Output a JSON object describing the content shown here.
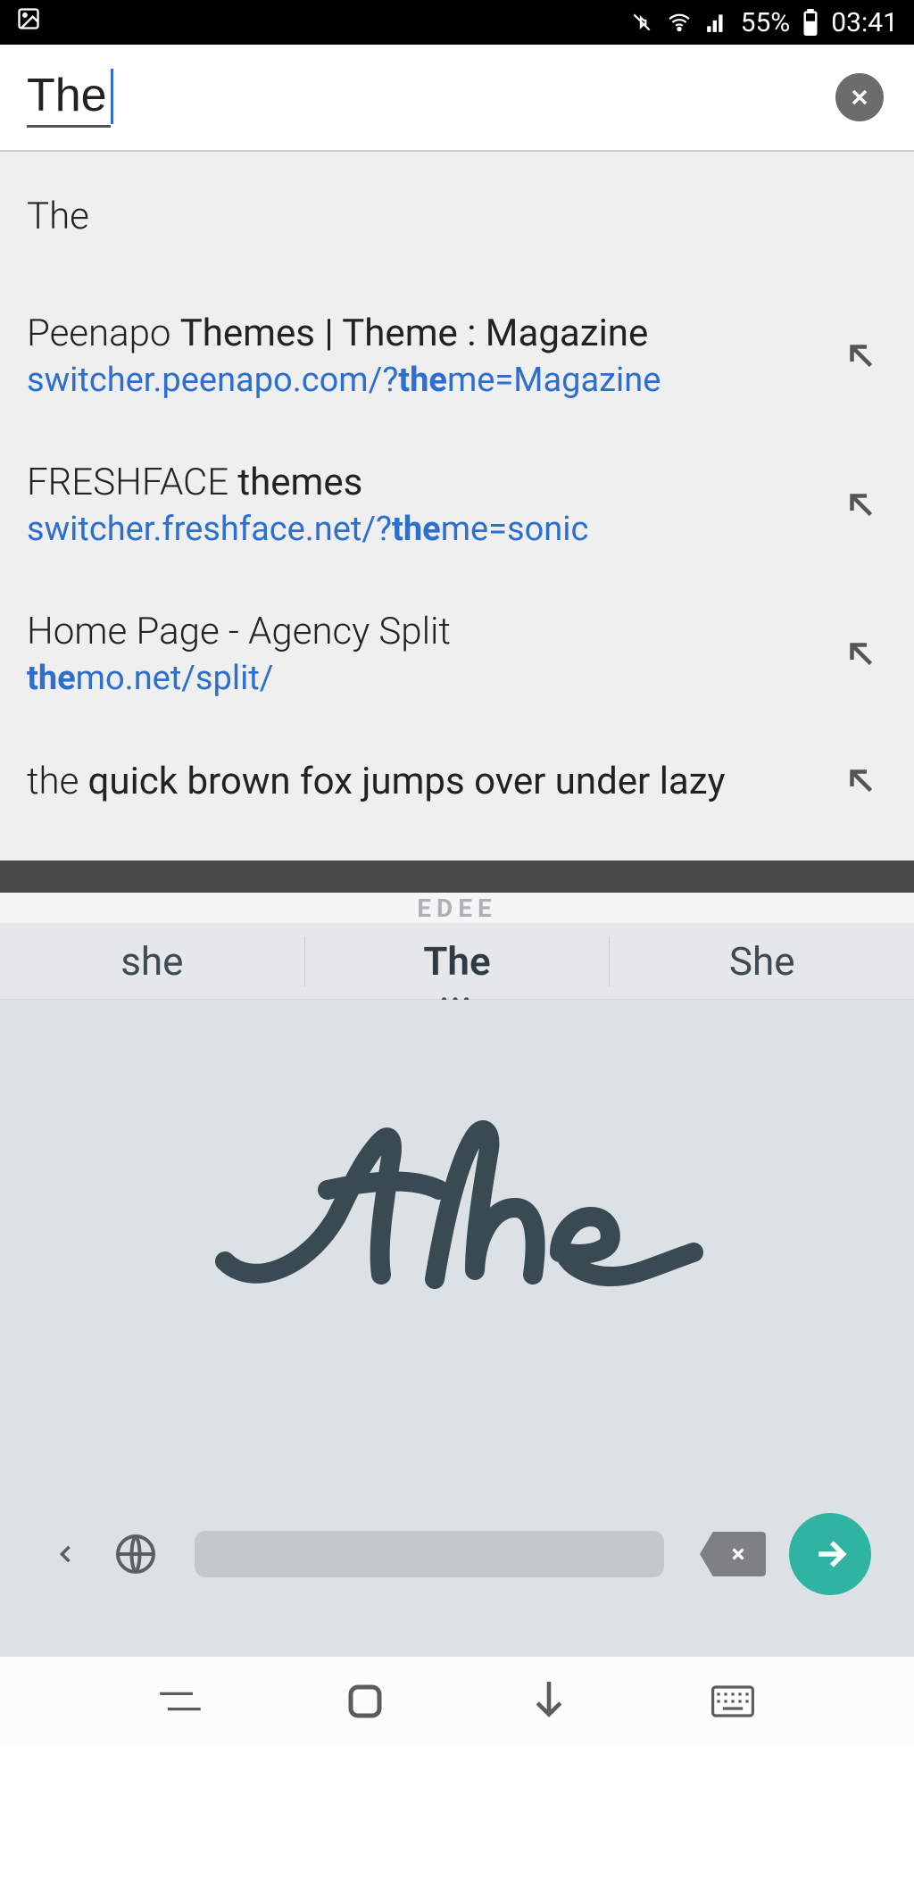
{
  "status": {
    "battery": "55%",
    "time": "03:41"
  },
  "search": {
    "value": "The"
  },
  "suggestions": [
    {
      "title_light": "The",
      "title_bold": "",
      "url": ""
    },
    {
      "title_light": "Peenapo ",
      "title_bold": "Themes | Theme : Magazine",
      "url_pre": "switcher.peenapo.com/?",
      "url_bold": "the",
      "url_post": "me=Magazine"
    },
    {
      "title_light": "FRESHFACE ",
      "title_bold": "themes",
      "url_pre": "switcher.freshface.net/?",
      "url_bold": "the",
      "url_post": "me=sonic"
    },
    {
      "title_light": "Home Page - Agency Split",
      "title_bold": "",
      "url_pre": "",
      "url_bold": "the",
      "url_post": "mo.net/split/"
    },
    {
      "title_light": "the ",
      "title_bold": "quick brown fox jumps over under lazy",
      "url": ""
    }
  ],
  "peek": "EDEE",
  "candidates": [
    "she",
    "The",
    "She"
  ],
  "handwriting_text": "The"
}
